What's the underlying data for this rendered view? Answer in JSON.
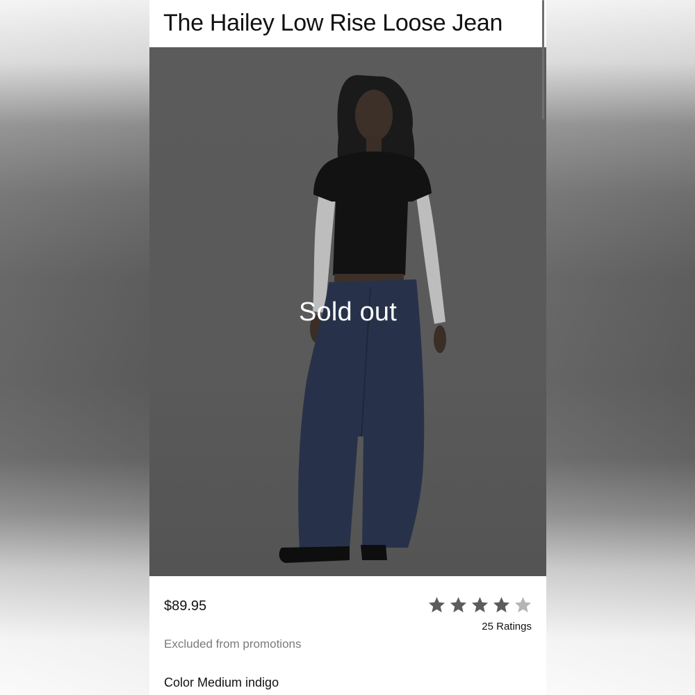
{
  "product": {
    "title": "The Hailey Low Rise Loose Jean",
    "overlay_label": "Sold out",
    "price": "$89.95",
    "rating": {
      "value": 4,
      "max": 5,
      "count_label": "25 Ratings"
    },
    "promotion_note": "Excluded from promotions",
    "color_label": "Color Medium indigo"
  },
  "colors": {
    "star_filled": "#5c5c5c",
    "star_empty": "#b5b5b5",
    "overlay_bg": "#5a5a5a",
    "denim": "#27324a"
  },
  "icons": {
    "star": "star-icon"
  }
}
